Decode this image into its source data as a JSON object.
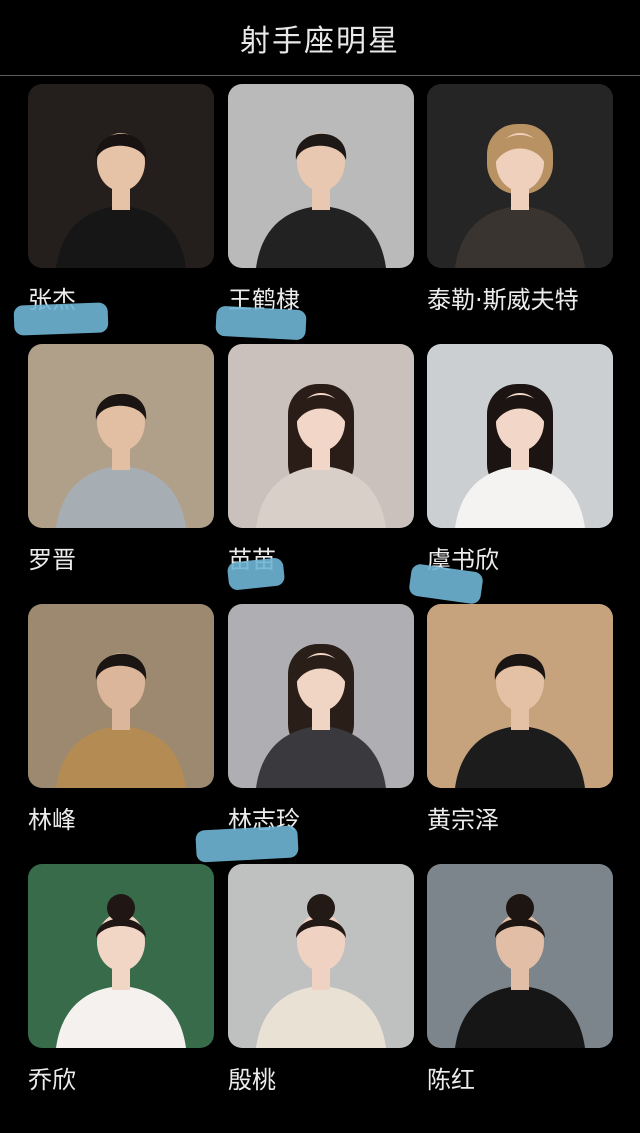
{
  "header": {
    "title": "射手座明星"
  },
  "celebrities": [
    {
      "name": "张杰",
      "bg": "#2a2420",
      "skin": "#e6c2a6",
      "hair": "#181312",
      "outfit": "#161616",
      "hair_style": "short"
    },
    {
      "name": "王鹤棣",
      "bg": "#d4d4d4",
      "skin": "#e8c8b0",
      "hair": "#1d1715",
      "outfit": "#222222",
      "hair_style": "short"
    },
    {
      "name": "泰勒·斯威夫特",
      "bg": "#2b2b2b",
      "skin": "#efd0bc",
      "hair": "#b99263",
      "outfit": "#3a3430",
      "hair_style": "bob"
    },
    {
      "name": "罗晋",
      "bg": "#c9b79c",
      "skin": "#e2bea2",
      "hair": "#1a1512",
      "outfit": "#a7aeb3",
      "hair_style": "short"
    },
    {
      "name": "苗苗",
      "bg": "#e6dcd6",
      "skin": "#f2d6c8",
      "hair": "#2a1d18",
      "outfit": "#d8d0c8",
      "hair_style": "long"
    },
    {
      "name": "虞书欣",
      "bg": "#e8ecef",
      "skin": "#f2d6c8",
      "hair": "#1b1412",
      "outfit": "#f5f3f2",
      "hair_style": "long"
    },
    {
      "name": "林峰",
      "bg": "#b39c80",
      "skin": "#dcb69a",
      "hair": "#1a1512",
      "outfit": "#b48b52",
      "hair_style": "short"
    },
    {
      "name": "林志玲",
      "bg": "#c8c8cc",
      "skin": "#f0d4c4",
      "hair": "#2a1e18",
      "outfit": "#3a3a3e",
      "hair_style": "long"
    },
    {
      "name": "黄宗泽",
      "bg": "#e2b98f",
      "skin": "#e4c0a4",
      "hair": "#1a1512",
      "outfit": "#1c1c1c",
      "hair_style": "short"
    },
    {
      "name": "乔欣",
      "bg": "#3f7a55",
      "skin": "#f1d6c6",
      "hair": "#201613",
      "outfit": "#f4f1ee",
      "hair_style": "bun"
    },
    {
      "name": "殷桃",
      "bg": "#dadcdc",
      "skin": "#efd2c2",
      "hair": "#231915",
      "outfit": "#e9e2d4",
      "hair_style": "bun"
    },
    {
      "name": "陈红",
      "bg": "#8e98a0",
      "skin": "#e2bea6",
      "hair": "#1c1512",
      "outfit": "#161616",
      "hair_style": "bun"
    }
  ],
  "colors": {
    "background": "#000000",
    "text": "#ececec",
    "divider": "#5a5a5a",
    "highlight_marker": "#6fb6d6"
  }
}
